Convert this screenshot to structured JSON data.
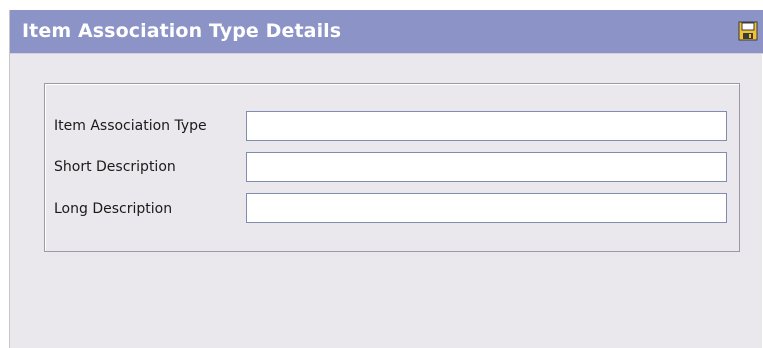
{
  "header": {
    "title": "Item Association Type Details",
    "save_icon": "floppy-disk-save-icon"
  },
  "form": {
    "fields": [
      {
        "label": "Item Association Type",
        "value": ""
      },
      {
        "label": "Short Description",
        "value": ""
      },
      {
        "label": "Long Description",
        "value": ""
      }
    ]
  },
  "colors": {
    "titlebar_bg": "#8b93c7",
    "window_bg": "#eae8ec",
    "field_border": "#7f8db0"
  }
}
